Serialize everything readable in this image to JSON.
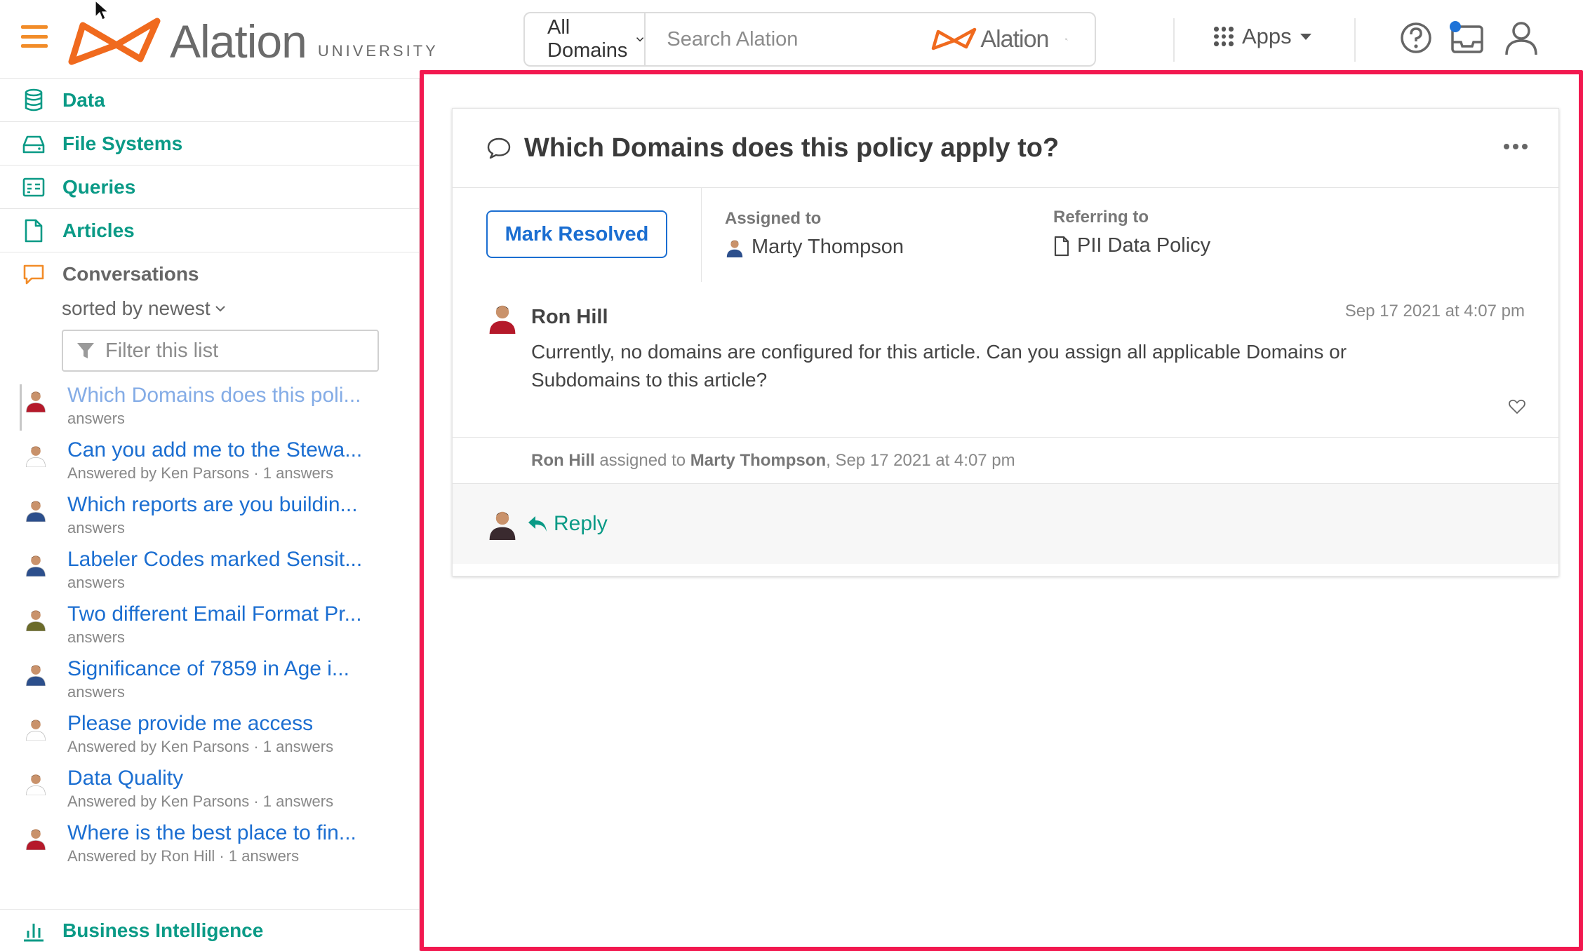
{
  "header": {
    "logo_word": "Alation",
    "logo_sub": "UNIVERSITY",
    "domain_select": "All Domains",
    "search_placeholder": "Search Alation",
    "search_brand": "Alation",
    "apps_label": "Apps"
  },
  "sidebar": {
    "nav": [
      {
        "label": "Data",
        "icon": "database-icon"
      },
      {
        "label": "File Systems",
        "icon": "drive-icon"
      },
      {
        "label": "Queries",
        "icon": "query-icon"
      },
      {
        "label": "Articles",
        "icon": "article-icon"
      }
    ],
    "conversations": {
      "label": "Conversations",
      "sort_label": "sorted by newest",
      "filter_placeholder": "Filter this list",
      "items": [
        {
          "title": "Which Domains does this poli...",
          "sub": "answers",
          "active": true
        },
        {
          "title": "Can you add me to the Stewa...",
          "sub": "Answered by Ken Parsons · 1 answers"
        },
        {
          "title": "Which reports are you buildin...",
          "sub": "answers"
        },
        {
          "title": "Labeler Codes marked Sensit...",
          "sub": "answers"
        },
        {
          "title": "Two different Email Format Pr...",
          "sub": "answers"
        },
        {
          "title": "Significance of 7859 in Age i...",
          "sub": "answers"
        },
        {
          "title": "Please provide me access",
          "sub": "Answered by Ken Parsons · 1 answers"
        },
        {
          "title": "Data Quality",
          "sub": "Answered by Ken Parsons · 1 answers"
        },
        {
          "title": "Where is the best place to fin...",
          "sub": "Answered by Ron Hill · 1 answers"
        }
      ]
    },
    "bottom_label": "Business Intelligence"
  },
  "conversation": {
    "title": "Which Domains does this policy apply to?",
    "resolve_label": "Mark Resolved",
    "assigned_label": "Assigned to",
    "assigned_name": "Marty Thompson",
    "referring_label": "Referring to",
    "referring_item": "PII Data Policy",
    "comment": {
      "author": "Ron Hill",
      "time": "Sep 17 2021 at 4:07 pm",
      "body": "Currently, no domains are configured for this article.  Can you assign all applicable Domains or Subdomains to this article?"
    },
    "activity": {
      "actor": "Ron Hill",
      "verb": "assigned to",
      "target": "Marty Thompson",
      "time": ", Sep 17 2021 at 4:07 pm"
    },
    "reply_label": "Reply"
  },
  "colors": {
    "accent_teal": "#0a9a86",
    "link_blue": "#1b6ed1",
    "brand_orange": "#f28c28",
    "highlight_border": "#f2184f"
  }
}
